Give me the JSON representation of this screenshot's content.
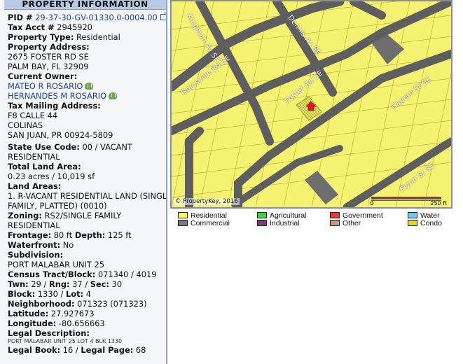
{
  "panel": {
    "title": "PROPERTY INFORMATION",
    "pid_label": "PID #",
    "pid_value": "29-37-30-GV-01330.0-0004.00",
    "tax_acct_label": "Tax Acct #",
    "tax_acct_value": "2945920",
    "property_type_label": "Property Type:",
    "property_type_value": "Residential",
    "property_address_label": "Property Address:",
    "address_line1": "2675 FOSTER RD SE",
    "address_line2": "PALM BAY, FL 32909",
    "current_owner_label": "Current Owner:",
    "owners": [
      "MATEO R ROSARIO",
      "HERNANDES M ROSARIO"
    ],
    "mailing_label": "Tax Mailing Address:",
    "mailing_lines": [
      "F8 CALLE 44",
      "COLINAS",
      "SAN JUAN, PR 00924-5809"
    ],
    "state_use_label": "State Use Code:",
    "state_use_value": "00 / VACANT",
    "state_use_value2": "RESIDENTIAL",
    "land_area_label": "Total Land Area:",
    "land_area_value": "0.23 acres / 10,019 sf",
    "land_areas_label": "Land Areas:",
    "land_areas_line1": "1. R-VACANT RESIDENTIAL LAND (SINGLE",
    "land_areas_line2": "FAMILY, PLATTED) (0010)",
    "zoning_label": "Zoning:",
    "zoning_value": "RS2/SINGLE FAMILY",
    "zoning_value2": "RESIDENTIAL",
    "frontage_label": "Frontage:",
    "frontage_value": "80 ft",
    "depth_label": "Depth:",
    "depth_value": "125 ft",
    "waterfront_label": "Waterfront:",
    "waterfront_value": "No",
    "subdivision_label": "Subdivision:",
    "subdivision_value": "PORT MALABAR UNIT 25",
    "census_label": "Census Tract/Block:",
    "census_value": "071340 / 4019",
    "twn_label": "Twn:",
    "twn_value": "29",
    "rng_label": "Rng:",
    "rng_value": "37",
    "sec_label": "Sec:",
    "sec_value": "30",
    "block_label": "Block:",
    "block_value": "1330",
    "lot_label": "Lot:",
    "lot_value": "4",
    "neighborhood_label": "Neighborhood:",
    "neighborhood_value": "071323 (071323)",
    "latitude_label": "Latitude:",
    "latitude_value": "27.927673",
    "longitude_label": "Longitude:",
    "longitude_value": "-80.656663",
    "legal_desc_label": "Legal Description:",
    "legal_desc_value": "PORT MALABAR UNIT 25 LOT 4 BLK 1330",
    "legal_book_label": "Legal Book:",
    "legal_book_value": "16",
    "legal_page_label": "Legal Page:",
    "legal_page_value": "68"
  },
  "map": {
    "streets": [
      "Kingman Av SE",
      "Dennis Av SE",
      "Gainsville Rd SE",
      "Foster Rd SE",
      "Capron St SE",
      "Flynn St SE"
    ],
    "copyright": "© PropertyKey, 2016",
    "scale_start": "0",
    "scale_end": "250 ft"
  },
  "legend": [
    {
      "label": "Residential",
      "color": "#fdf76a"
    },
    {
      "label": "Agricultural",
      "color": "#3fd14a"
    },
    {
      "label": "Government",
      "color": "#e03a3a"
    },
    {
      "label": "Water",
      "color": "#74c6f2"
    },
    {
      "label": "Commercial",
      "color": "#7a7a7a"
    },
    {
      "label": "Industrial",
      "color": "#7d3f73"
    },
    {
      "label": "Other",
      "color": "#c69a7a"
    },
    {
      "label": "Condo",
      "color": "#e1da1c"
    }
  ]
}
